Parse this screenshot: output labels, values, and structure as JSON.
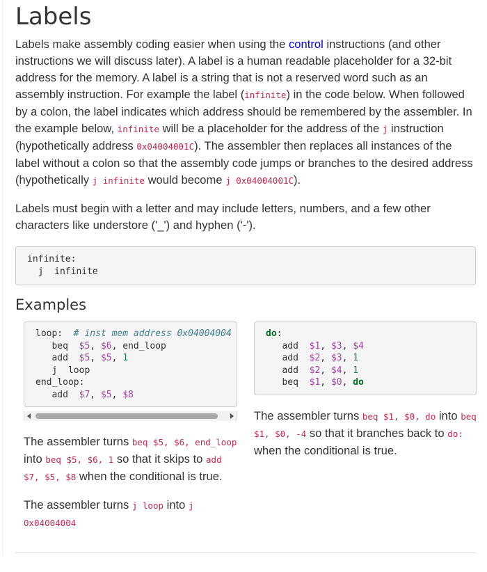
{
  "heading": "Labels",
  "intro": {
    "t1": "Labels make assembly coding easier when using the ",
    "link_control": "control",
    "t2": " instructions (and other instructions we will discuss later). A label is a human readable placeholder for a 32-bit address for the memory. A label is a string that is not a reserved word such as an assembly instruction. For example the label (",
    "c1": "infinite",
    "t3": ") in the code below. When followed by a colon, the label indicates which address should be remembered by the assembler. In the example below, ",
    "c2": "infinite",
    "t4": " will be a placeholder for the address of the ",
    "c3": "j",
    "t5": " instruction (hypothetically address ",
    "c4": "0x04004001C",
    "t6": "). The assembler then replaces all instances of the label without a colon so that the assembly code jumps or branches to the desired address (hypothetically ",
    "c5": "j infinite",
    "t7": " would become ",
    "c6": "j 0x04004001C",
    "t8": ")."
  },
  "rules_paragraph": "Labels must begin with a letter and may include letters, numbers, and a few other characters like understore ('_') and hyphen ('-').",
  "main_code": {
    "line1": "infinite:",
    "line2": "  j  infinite"
  },
  "examples_heading": "Examples",
  "example_left": {
    "code": {
      "l1_label": "loop:",
      "l1_comment": "# inst mem address 0x04004004",
      "l2_op": "beq",
      "l2_r1": "$5",
      "l2_r2": "$6",
      "l2_target": "end_loop",
      "l3_op": "add",
      "l3_r1": "$5",
      "l3_r2": "$5",
      "l3_imm": "1",
      "l4_op": "j",
      "l4_target": "loop",
      "l5_label": "end_loop:",
      "l6_op": "add",
      "l6_r1": "$7",
      "l6_r2": "$5",
      "l6_r3": "$8"
    },
    "p1": {
      "t1": "The assembler turns ",
      "c1": "beq $5, $6, end_loop",
      "t2": " into ",
      "c2": "beq $5, $6, 1",
      "t3": " so that it skips to ",
      "c3": "add $7, $5, $8",
      "t4": " when the conditional is true."
    },
    "p2": {
      "t1": "The assembler turns ",
      "c1": "j loop",
      "t2": " into ",
      "c2": "j 0x04004004"
    }
  },
  "example_right": {
    "code": {
      "l1_label": "do",
      "l1_colon": ":",
      "l2_op": "add",
      "l2_r1": "$1",
      "l2_r2": "$3",
      "l2_r3": "$4",
      "l3_op": "add",
      "l3_r1": "$2",
      "l3_r2": "$3",
      "l3_imm": "1",
      "l4_op": "add",
      "l4_r1": "$2",
      "l4_r2": "$4",
      "l4_imm": "1",
      "l5_op": "beq",
      "l5_r1": "$1",
      "l5_r2": "$0",
      "l5_target": "do"
    },
    "p1": {
      "t1": "The assembler turns ",
      "c1": "beq $1, $0, do",
      "t2": " into ",
      "c2": "beq $1, $0, -4",
      "t3": " so that it branches back to ",
      "c3": "do:",
      "t4": " when the conditional is true."
    }
  }
}
